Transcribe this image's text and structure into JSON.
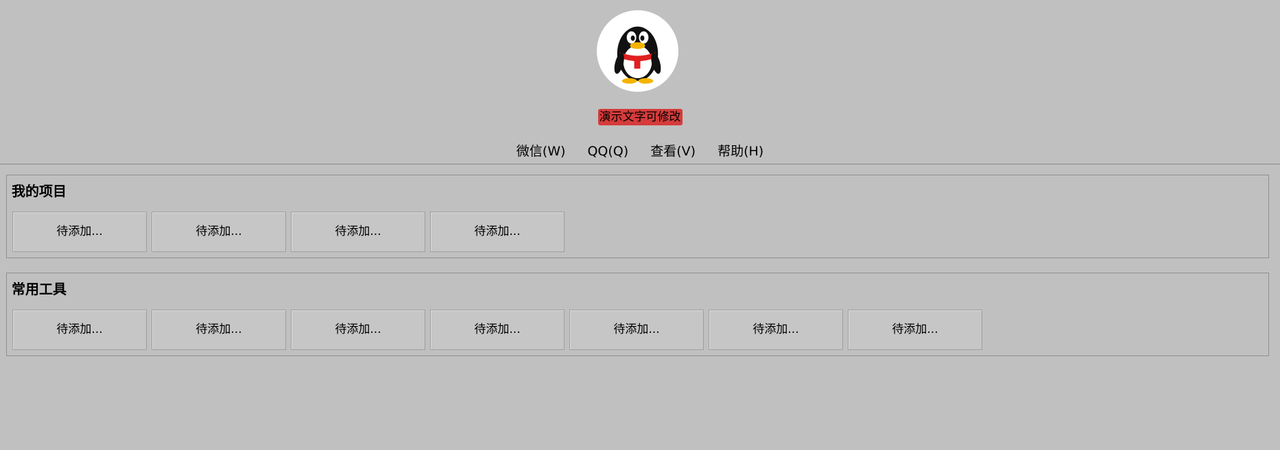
{
  "header": {
    "avatar_icon": "qq-penguin-icon",
    "banner_text": "演示文字可修改",
    "banner_color": "#d63b3b"
  },
  "menu": {
    "items": [
      {
        "label": "微信(W)"
      },
      {
        "label": "QQ(Q)"
      },
      {
        "label": "查看(V)"
      },
      {
        "label": "帮助(H)"
      }
    ]
  },
  "groups": {
    "projects": {
      "title": "我的项目",
      "buttons": [
        "待添加...",
        "待添加...",
        "待添加...",
        "待添加..."
      ]
    },
    "tools": {
      "title": "常用工具",
      "buttons": [
        "待添加...",
        "待添加...",
        "待添加...",
        "待添加...",
        "待添加...",
        "待添加...",
        "待添加..."
      ]
    }
  },
  "colors": {
    "background": "#c0c0c0",
    "accent_red": "#d63b3b"
  }
}
